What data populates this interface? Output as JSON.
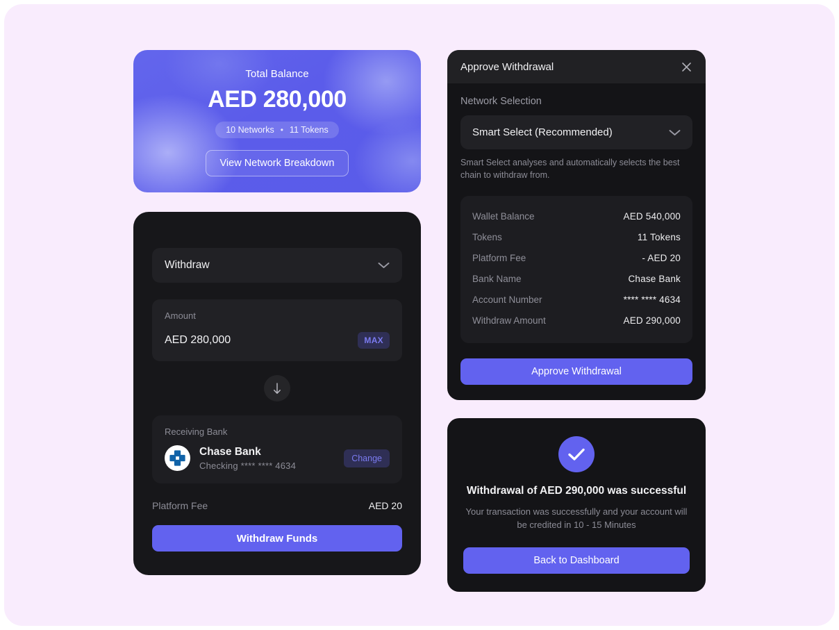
{
  "theme": {
    "page_background": "#f9ecfd",
    "accent": "#6262ef",
    "card_background": "#17171a",
    "field_background": "#212125",
    "muted_text": "#8d8d97"
  },
  "balance_card": {
    "label": "Total Balance",
    "amount": "AED 280,000",
    "networks": "10 Networks",
    "separator": "•",
    "tokens": "11 Tokens",
    "breakdown_button": "View Network Breakdown"
  },
  "withdraw_card": {
    "action_select": {
      "value": "Withdraw",
      "chevron_icon": "chevron-down-icon"
    },
    "amount": {
      "label": "Amount",
      "value": "AED 280,000",
      "max_label": "MAX"
    },
    "swap_icon": "arrow-down-icon",
    "bank": {
      "label": "Receiving Bank",
      "logo_icon": "chase-bank-logo-icon",
      "name": "Chase Bank",
      "account": "Checking **** **** 4634",
      "change_label": "Change"
    },
    "fee": {
      "label": "Platform Fee",
      "value": "AED 20"
    },
    "submit_label": "Withdraw Funds"
  },
  "approve_modal": {
    "title": "Approve Withdrawal",
    "close_icon": "close-icon",
    "network_section_label": "Network Selection",
    "network_value": "Smart Select (Recommended)",
    "network_chevron_icon": "chevron-down-icon",
    "helper_text": "Smart Select analyses and automatically selects the best chain to withdraw from.",
    "details": [
      {
        "key": "Wallet Balance",
        "value": "AED 540,000"
      },
      {
        "key": "Tokens",
        "value": "11 Tokens"
      },
      {
        "key": "Platform Fee",
        "value": "- AED 20"
      },
      {
        "key": "Bank Name",
        "value": "Chase Bank"
      },
      {
        "key": "Account Number",
        "value": "**** **** 4634"
      },
      {
        "key": "Withdraw Amount",
        "value": "AED 290,000"
      }
    ],
    "approve_label": "Approve Withdrawal"
  },
  "success_card": {
    "check_icon": "check-icon",
    "title": "Withdrawal of AED 290,000 was successful",
    "subtitle": "Your transaction was successfully and your account will be credited in 10 - 15 Minutes",
    "button_label": "Back to Dashboard"
  }
}
